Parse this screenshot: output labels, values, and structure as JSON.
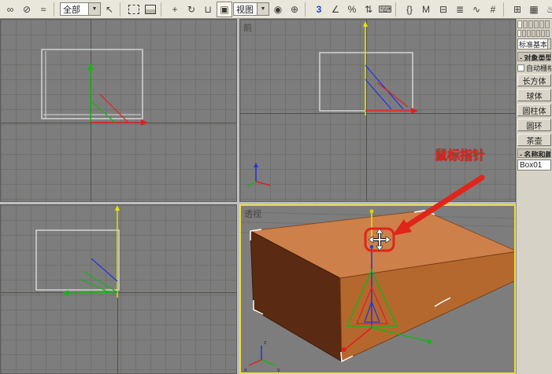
{
  "toolbar": {
    "selection_filter": "全部",
    "coord_system": "视图",
    "icons": {
      "link": "∞",
      "unlink": "⊘",
      "bind": "≈",
      "select": "↖",
      "move": "+",
      "rotate": "↻",
      "uscale": "⊔",
      "scale": "▣",
      "pivot": "◉",
      "manipulate": "⊕",
      "snap3": "3",
      "anglesnap": "∠",
      "percentsnap": "%",
      "spinnersnap": "⇅",
      "keyboard": "⌨",
      "namedsets": "{}",
      "mirror": "M",
      "align": "⊟",
      "layers": "≣",
      "curves": "∿",
      "schematic": "#",
      "material": "⊞",
      "render": "▦",
      "teapot": "♨"
    }
  },
  "ui": {
    "dropdown_arrow": "▼"
  },
  "viewports": {
    "front_label": "前",
    "perspective_label": "透视",
    "axis_labels": {
      "x": "x",
      "y": "y",
      "z": "z"
    }
  },
  "annotation": {
    "label": "鼠标指针"
  },
  "command_panel": {
    "category_dropdown": "标准基本",
    "object_type_rollout": "- 对象类型",
    "autogrid_label": "自动栅格",
    "object_buttons": [
      "长方体",
      "球体",
      "圆柱体",
      "圆环",
      "茶壶"
    ],
    "name_rollout": "- 名称和颜色",
    "object_name": "Box01"
  },
  "colors": {
    "active_viewport_border": "#e8dc4a",
    "annotation_red": "#e0251b",
    "box_top": "#cd8049",
    "box_left": "#5a2a12",
    "box_right": "#b5682e",
    "axis_x": "#e02020",
    "axis_y": "#19b219",
    "axis_z": "#2233dd",
    "selected_axis": "#e6e600"
  }
}
